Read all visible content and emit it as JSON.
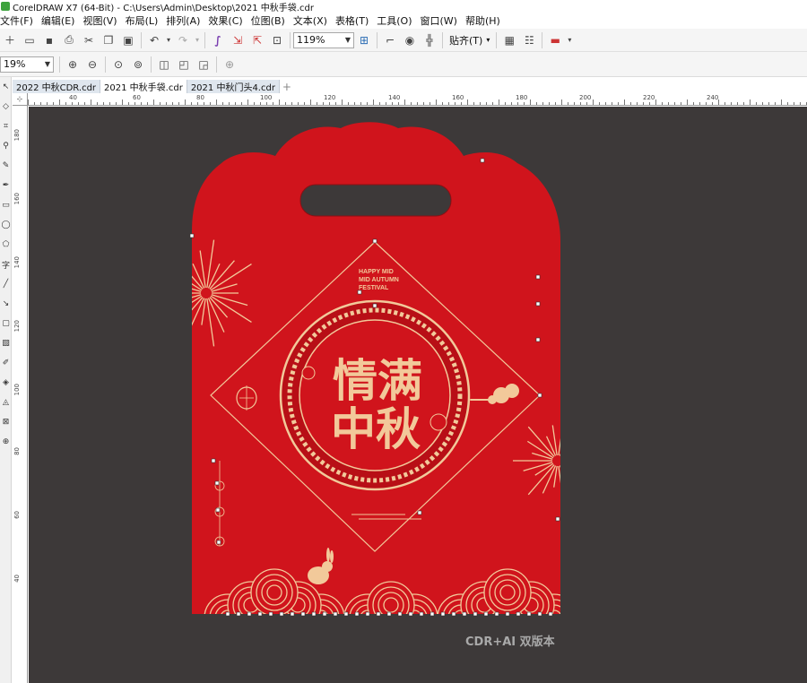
{
  "window": {
    "title": "CorelDRAW X7 (64-Bit) - C:\\Users\\Admin\\Desktop\\2021 中秋手袋.cdr"
  },
  "menu": [
    "文件(F)",
    "编辑(E)",
    "视图(V)",
    "布局(L)",
    "排列(A)",
    "效果(C)",
    "位图(B)",
    "文本(X)",
    "表格(T)",
    "工具(O)",
    "窗口(W)",
    "帮助(H)"
  ],
  "toolbar": {
    "zoom_value": "119%",
    "snap_label": "贴齐(T)"
  },
  "propbar": {
    "zoom_value": "19%"
  },
  "tabs": [
    {
      "label": "2022 中秋CDR.cdr",
      "active": false
    },
    {
      "label": "2021 中秋手袋.cdr",
      "active": true
    },
    {
      "label": "2021 中秋门头4.cdr",
      "active": false
    }
  ],
  "ruler": {
    "h_ticks": [
      "40",
      "60",
      "80",
      "100",
      "120",
      "140",
      "160",
      "180",
      "200",
      "220",
      "240"
    ],
    "v_ticks": [
      "180",
      "160",
      "140",
      "120",
      "100",
      "80",
      "60",
      "40"
    ]
  },
  "design": {
    "english_line1": "HAPPY MID",
    "english_line2": "MID AUTUMN",
    "english_line3": "FESTIVAL",
    "title_row1": "情满",
    "title_row2": "中秋"
  },
  "watermark": "CDR+AI 双版本",
  "colors": {
    "canvas": "#3d3939",
    "bag_red": "#d0141c",
    "dark_red": "#a50e14",
    "gold": "#f2c99a",
    "handle": "#3d3939"
  }
}
